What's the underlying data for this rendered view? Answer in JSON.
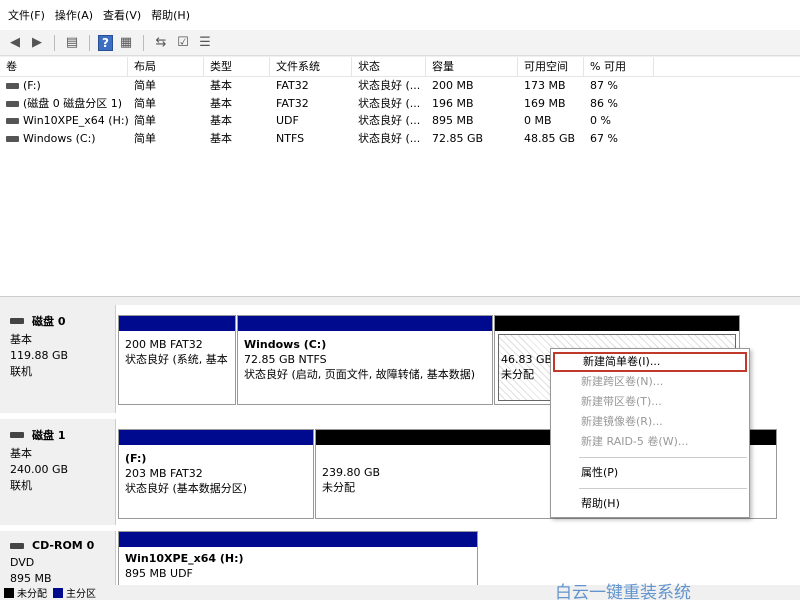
{
  "menu": [
    "文件(F)",
    "操作(A)",
    "查看(V)",
    "帮助(H)"
  ],
  "list": {
    "headers": [
      "卷",
      "布局",
      "类型",
      "文件系统",
      "状态",
      "容量",
      "可用空间",
      "% 可用"
    ],
    "rows": [
      [
        "(F:)",
        "简单",
        "基本",
        "FAT32",
        "状态良好 (...",
        "200 MB",
        "173 MB",
        "87 %"
      ],
      [
        "(磁盘 0 磁盘分区 1)",
        "简单",
        "基本",
        "FAT32",
        "状态良好 (...",
        "196 MB",
        "169 MB",
        "86 %"
      ],
      [
        "Win10XPE_x64 (H:)",
        "简单",
        "基本",
        "UDF",
        "状态良好 (...",
        "895 MB",
        "0 MB",
        "0 %"
      ],
      [
        "Windows (C:)",
        "简单",
        "基本",
        "NTFS",
        "状态良好 (...",
        "72.85 GB",
        "48.85 GB",
        "67 %"
      ]
    ]
  },
  "disks": [
    {
      "title": "磁盘 0",
      "kind": "基本",
      "size": "119.88 GB",
      "state": "联机",
      "parts": [
        {
          "name": "",
          "line1": "200 MB FAT32",
          "line2": "状态良好 (系统, 基本"
        },
        {
          "name": "Windows  (C:)",
          "line1": "72.85 GB NTFS",
          "line2": "状态良好 (启动, 页面文件, 故障转储, 基本数据)"
        },
        {
          "name": "",
          "line1": "46.83 GB",
          "line2": "未分配"
        }
      ]
    },
    {
      "title": "磁盘 1",
      "kind": "基本",
      "size": "240.00 GB",
      "state": "联机",
      "parts": [
        {
          "name": "(F:)",
          "line1": "203 MB FAT32",
          "line2": "状态良好 (基本数据分区)"
        },
        {
          "name": "",
          "line1": "239.80 GB",
          "line2": "未分配"
        }
      ]
    },
    {
      "title": "CD-ROM 0",
      "kind": "DVD",
      "size": "895 MB",
      "state": "",
      "parts": [
        {
          "name": "Win10XPE_x64  (H:)",
          "line1": "895 MB UDF",
          "line2": ""
        }
      ]
    }
  ],
  "context_menu": {
    "items": [
      "新建简单卷(I)...",
      "新建跨区卷(N)...",
      "新建带区卷(T)...",
      "新建镜像卷(R)...",
      "新建 RAID-5 卷(W)...",
      "属性(P)",
      "帮助(H)"
    ]
  },
  "status": {
    "unallocated": "未分配",
    "primary": "主分区"
  },
  "watermark": "白云一键重装系统",
  "colors": {
    "primary_bar": "#000a8f",
    "unallocated_bar": "#000000",
    "highlight_outline": "#c0392b"
  }
}
